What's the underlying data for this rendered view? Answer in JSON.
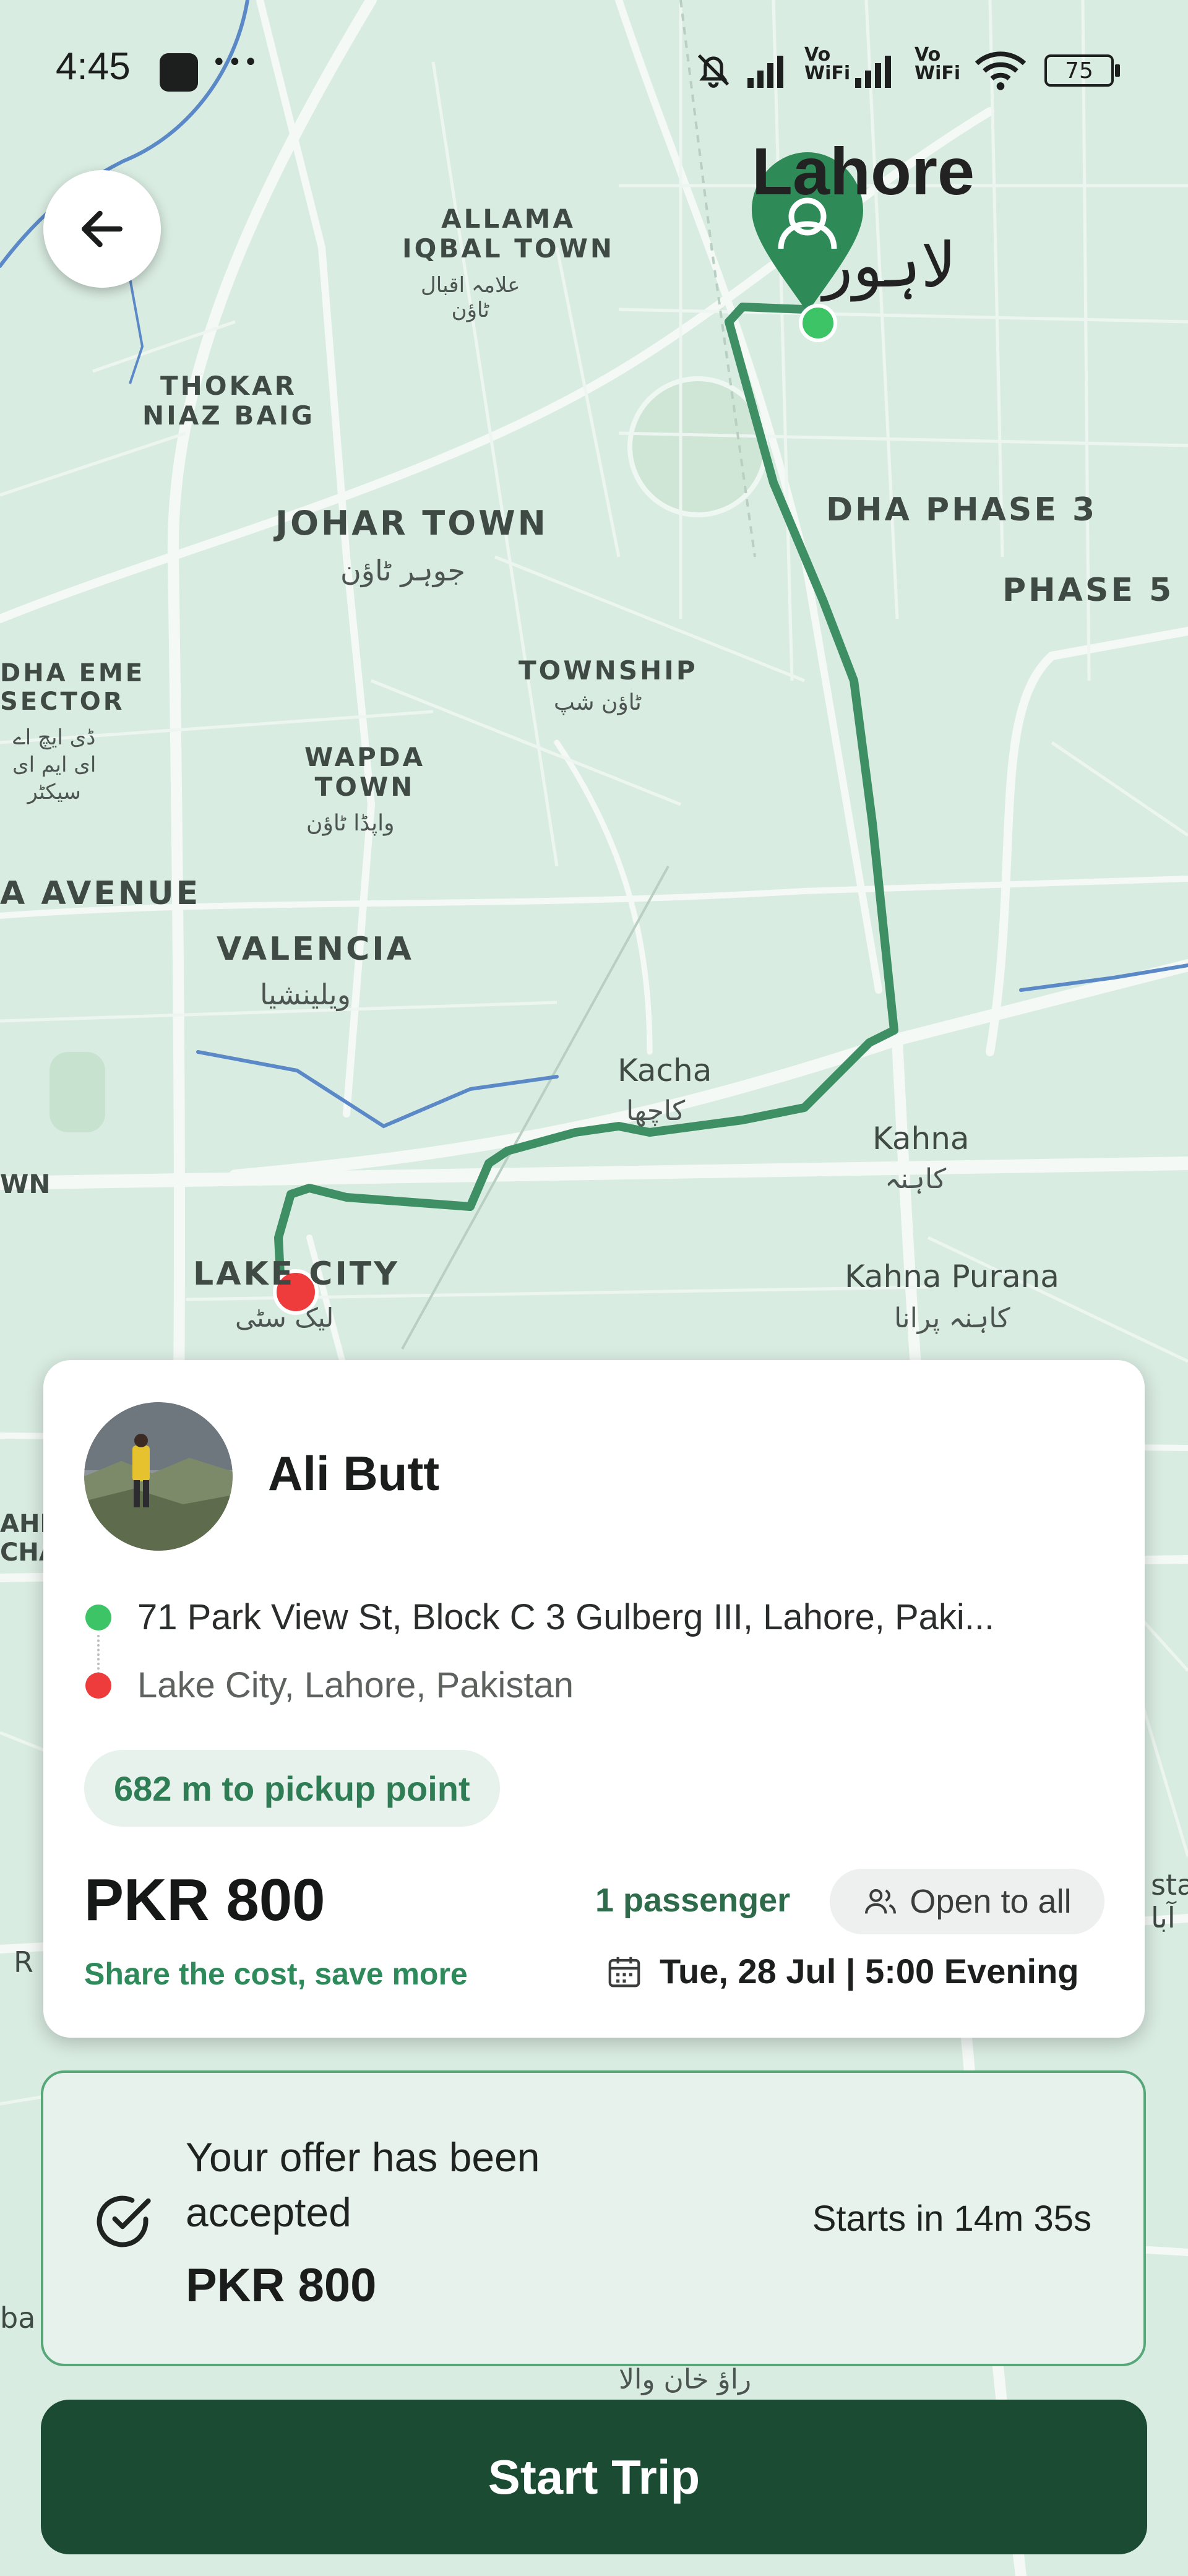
{
  "status_bar": {
    "time": "4:45",
    "dots": "•••",
    "vowifi_1": "Vo WiFi",
    "vowifi_2": "Vo WiFi",
    "battery": "75"
  },
  "map": {
    "labels": {
      "lahore": "Lahore",
      "lahore_ur": "لاہور",
      "allama_iqbal": "ALLAMA\nIQBAL TOWN",
      "allama_iqbal_ur": "علامہ اقبال\nٹاؤن",
      "thokar": "THOKAR\nNIAZ BAIG",
      "johar": "JOHAR TOWN",
      "johar_ur": "جوہر ٹاؤن",
      "dha3": "DHA PHASE 3",
      "phase5": "PHASE 5",
      "dha_eme": "DHA EME\nSECTOR",
      "dha_eme_ur": "ڈی ایچ اے\nای ایم ای\nسیکٹر",
      "township": "TOWNSHIP",
      "township_ur": "ٹاؤن شپ",
      "wapda": "WAPDA\nTOWN",
      "wapda_ur": "واپڈا ٹاؤن",
      "avenue": "A AVENUE",
      "valencia": "VALENCIA",
      "valencia_ur": "ویلینشیا",
      "kacha": "Kacha",
      "kacha_ur": "کاچھا",
      "kahna": "Kahna",
      "kahna_ur": "کاہنہ",
      "wn": "WN",
      "lake_city": "LAKE CITY",
      "lake_city_ur": "لیک سٹی",
      "kahna_purana": "Kahna Purana",
      "kahna_purana_ur": "کاہنہ پرانا",
      "rao_khan": "راؤ خان والا",
      "edge_ahr": "AHF\nCHA",
      "edge_r": "R",
      "edge_sta": "sta\nآبا",
      "edge_ba": "ba"
    }
  },
  "trip_card": {
    "rider_name": "Ali Butt",
    "pickup": "71 Park View St, Block C 3 Gulberg III, Lahore, Paki...",
    "dropoff": "Lake City, Lahore, Pakistan",
    "distance_to_pickup": "682 m to pickup point",
    "price": "PKR 800",
    "share_tagline": "Share the cost, save more",
    "passengers": "1 passenger",
    "visibility": "Open to all",
    "datetime": "Tue, 28 Jul | 5:00 Evening"
  },
  "offer": {
    "title": "Your offer has been accepted",
    "price": "PKR 800",
    "starts_in": "Starts in 14m 35s"
  },
  "actions": {
    "start_trip": "Start Trip"
  },
  "colors": {
    "route": "#3f8f64",
    "pickup_dot": "#3cc466",
    "dropoff_dot": "#ee3b3b",
    "primary_dark": "#1b4b33"
  }
}
